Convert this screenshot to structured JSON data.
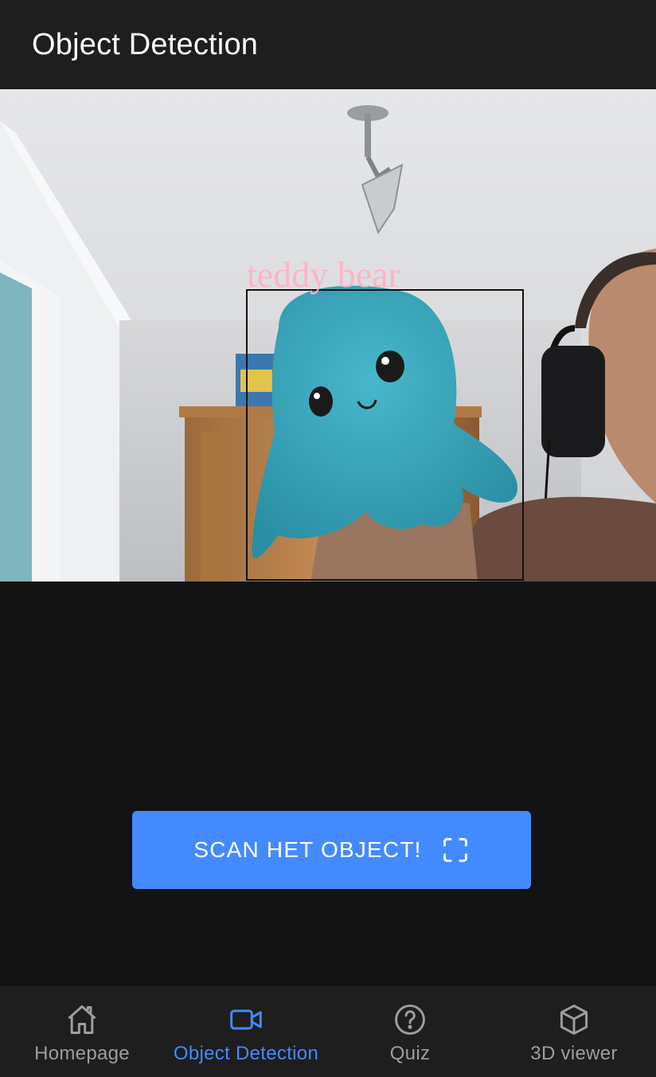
{
  "app_bar": {
    "title": "Object Detection"
  },
  "camera": {
    "detection": {
      "label": "teddy bear",
      "label_color": "#ffb3c6",
      "box_color": "#111111"
    }
  },
  "scan_button": {
    "label": "SCAN HET OBJECT!",
    "icon": "scan-frame-icon"
  },
  "bottom_nav": {
    "items": [
      {
        "label": "Homepage",
        "icon": "home-icon",
        "active": false
      },
      {
        "label": "Object Detection",
        "icon": "video-camera-icon",
        "active": true
      },
      {
        "label": "Quiz",
        "icon": "help-circle-icon",
        "active": false
      },
      {
        "label": "3D viewer",
        "icon": "cube-icon",
        "active": false
      }
    ]
  },
  "colors": {
    "accent": "#448aff",
    "background": "#131313",
    "app_bar": "#1e1e1e",
    "inactive_nav": "#9e9e9e"
  }
}
